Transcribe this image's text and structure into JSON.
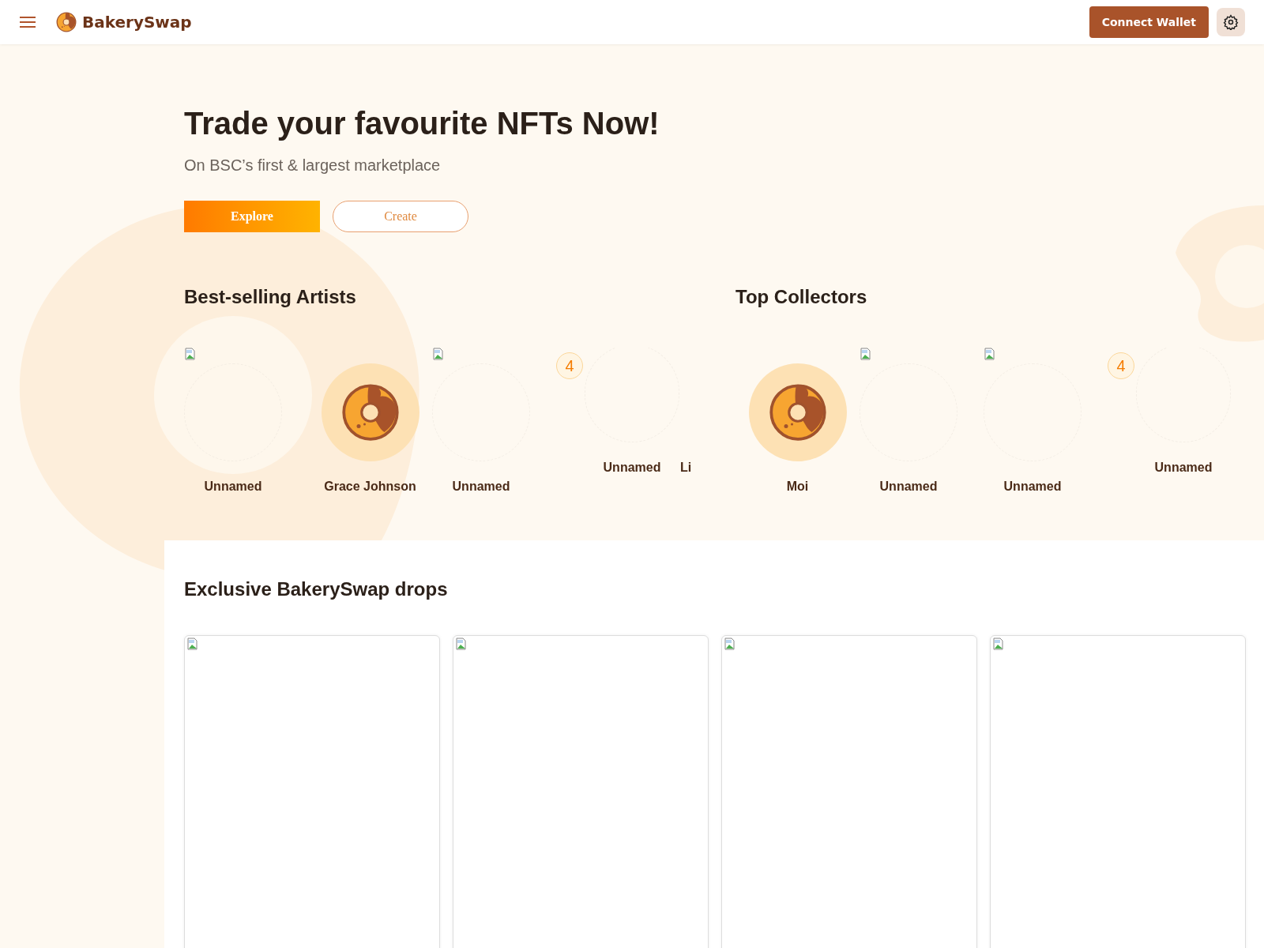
{
  "header": {
    "brand": "BakerySwap",
    "connect_button": "Connect Wallet"
  },
  "hero": {
    "title": "Trade your favourite NFTs Now!",
    "subtitle": "On BSC’s first & largest marketplace",
    "buttons": [
      {
        "label": "Explore",
        "kind": "primary"
      },
      {
        "label": "Create",
        "kind": "outline"
      }
    ]
  },
  "artists": {
    "title": "Best-selling Artists",
    "items": [
      {
        "name": "Unnamed",
        "kind": "broken"
      },
      {
        "name": "Grace Johnson",
        "kind": "avatar"
      },
      {
        "name": "Unnamed",
        "kind": "broken"
      },
      {
        "name": "Unnamed",
        "kind": "rank",
        "rank": "4"
      },
      {
        "name": "Li",
        "kind": "cut"
      }
    ]
  },
  "collectors": {
    "title": "Top Collectors",
    "items": [
      {
        "name": "Moi",
        "kind": "avatar"
      },
      {
        "name": "Unnamed",
        "kind": "broken"
      },
      {
        "name": "Unnamed",
        "kind": "broken"
      },
      {
        "name": "Unnamed",
        "kind": "rank",
        "rank": "4"
      }
    ]
  },
  "drops": {
    "title": "Exclusive BakerySwap drops",
    "cards": [
      {
        "kind": "broken"
      },
      {
        "kind": "broken"
      },
      {
        "kind": "broken"
      },
      {
        "kind": "broken"
      }
    ]
  }
}
